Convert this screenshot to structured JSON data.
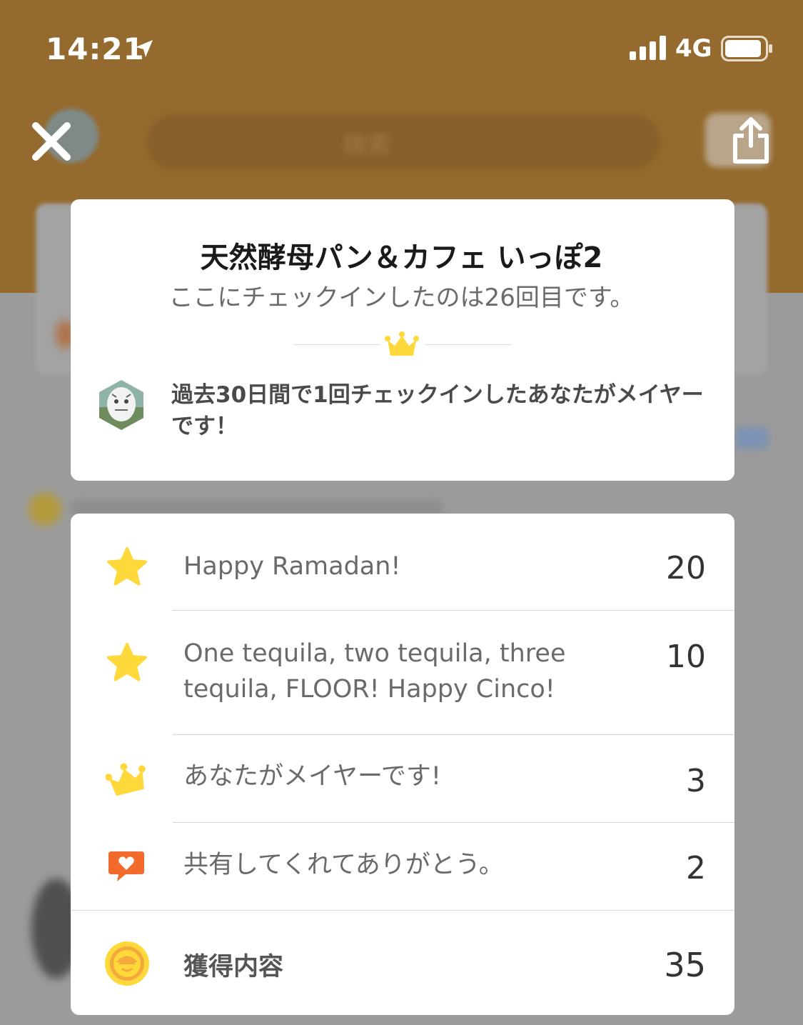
{
  "status_bar": {
    "time": "14:21",
    "network": "4G"
  },
  "toolbar": {
    "search_placeholder": "検索"
  },
  "venue": {
    "name": "天然酵母パン＆カフェ いっぽ2",
    "checkin_message": "ここにチェックインしたのは26回目です。",
    "mayor_message": "過去30日間で1回チェックインしたあなたがメイヤーです！"
  },
  "rewards": [
    {
      "icon": "star-icon",
      "label": "Happy Ramadan!",
      "points": "20"
    },
    {
      "icon": "star-icon",
      "label": "One tequila, two tequila, three tequila, FLOOR! Happy Cinco!",
      "points": "10"
    },
    {
      "icon": "crown-icon",
      "label": "あなたがメイヤーです!",
      "points": "3"
    },
    {
      "icon": "heart-speech-bubble-icon",
      "label": "共有してくれてありがとう。",
      "points": "2"
    }
  ],
  "total": {
    "icon": "coin-icon",
    "label": "獲得内容",
    "points": "35"
  },
  "colors": {
    "header_bg": "#956a2e",
    "star": "#ffd83b",
    "share_orange": "#f26b2c",
    "coin": "#ffc83d"
  }
}
